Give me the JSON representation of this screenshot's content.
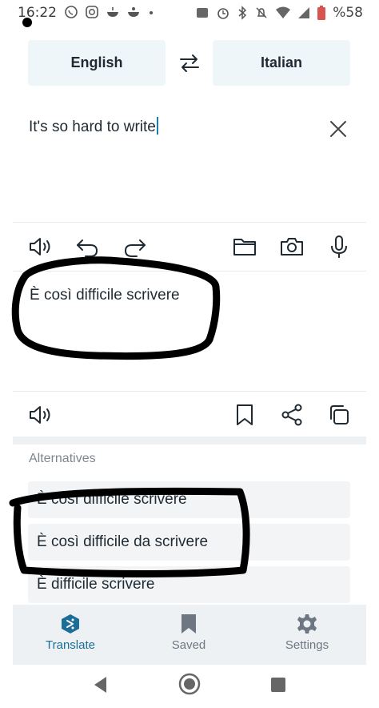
{
  "status_bar": {
    "time": "16:22",
    "battery": "%58",
    "left_icons": [
      "whatsapp-icon",
      "instagram-icon",
      "food-icon",
      "food-icon",
      "dot-icon"
    ],
    "right_icons": [
      "volte-icon",
      "alarm-icon",
      "bluetooth-icon",
      "mute-icon",
      "wifi-icon",
      "signal-icon",
      "battery-icon"
    ]
  },
  "languages": {
    "source": "English",
    "target": "Italian",
    "swap_icon": "swap-icon"
  },
  "source": {
    "text": "It's so hard to write"
  },
  "translation": {
    "text": "È così difficile scrivere"
  },
  "alternatives": {
    "title": "Alternatives",
    "items": [
      "È così difficile scrivere",
      "È così difficile da scrivere",
      "È difficile scrivere"
    ]
  },
  "bottom_nav": {
    "items": [
      {
        "label": "Translate",
        "icon": "translate-icon",
        "active": true
      },
      {
        "label": "Saved",
        "icon": "bookmark-icon",
        "active": false
      },
      {
        "label": "Settings",
        "icon": "gear-icon",
        "active": false
      }
    ]
  },
  "colors": {
    "accent": "#1a6e97",
    "language_button_bg": "#eef6f9",
    "annotation": "#000000"
  }
}
